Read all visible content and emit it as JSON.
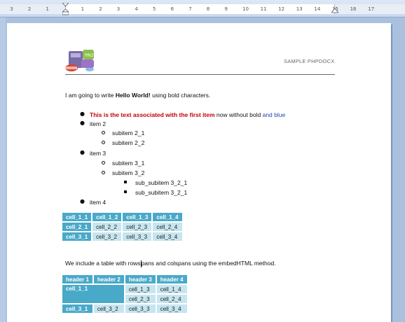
{
  "ruler": {
    "ticks_left": [
      "3",
      "2",
      "1"
    ],
    "ticks_right": [
      "1",
      "2",
      "3",
      "4",
      "5",
      "6",
      "7",
      "8",
      "9",
      "10",
      "11",
      "12",
      "13",
      "14",
      "15",
      "16",
      "17"
    ]
  },
  "header": {
    "label": "SAMPLE PHPDOCX",
    "logo_icon": "phpdocx-logo-icon"
  },
  "intro": {
    "prefix": "I am going to write ",
    "bold": "Hello World!",
    "suffix": " using bold characters."
  },
  "list": {
    "item1_red": "This is the text associated with the first item",
    "item1_mid": " now without bold ",
    "item1_blue": "and blue",
    "item2": "item 2",
    "sub2_1": "subitem 2_1",
    "sub2_2": "subitem 2_2",
    "item3": "item 3",
    "sub3_1": "subitem 3_1",
    "sub3_2": "subitem 3_2",
    "subsub1": "sub_subitem 3_2_1",
    "subsub2": "sub_subitem 3_2_1",
    "item4": "item 4"
  },
  "table1": {
    "rows": [
      [
        "cell_1_1",
        "cell_1_2",
        "cell_1_3",
        "cell_1_4"
      ],
      [
        "cell_2_1",
        "cell_2_2",
        "cell_2_3",
        "cell_2_4"
      ],
      [
        "cell_3_1",
        "cell_3_2",
        "cell_3_3",
        "cell_3_4"
      ]
    ]
  },
  "para2": {
    "before": "We include a table with rows",
    "after": "pans and colspans using the embedHTML method."
  },
  "table2": {
    "headers": [
      "header 1",
      "header 2",
      "header 3",
      "header 4"
    ],
    "merged": "cell_1_1",
    "r1": [
      "cell_1_3",
      "cell_1_4"
    ],
    "r2": [
      "cell_2_3",
      "cell_2_4"
    ],
    "r3": [
      "cell_3_1",
      "cell_3_2",
      "cell_3_3",
      "cell_3_4"
    ]
  },
  "colors": {
    "header_cell": "#49a9c9",
    "light_cell": "#c6e5ef",
    "red_text": "#c00000",
    "blue_text": "#1f3fb8"
  }
}
